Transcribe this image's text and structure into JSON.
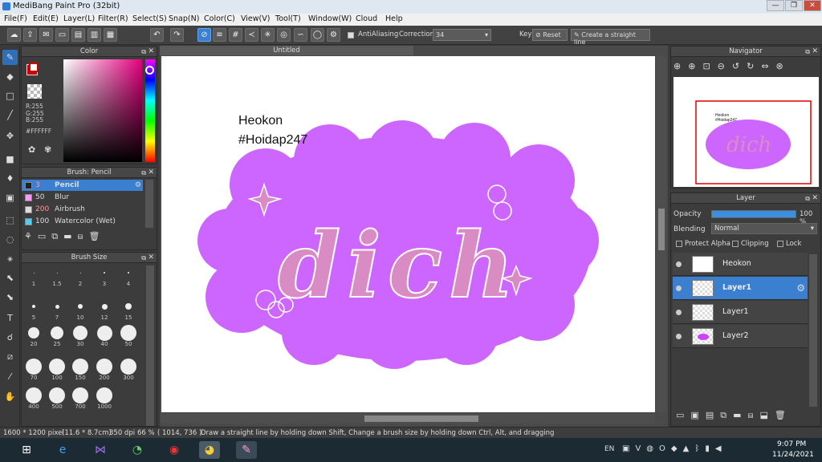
{
  "window": {
    "title": "MediBang Paint Pro (32bit)",
    "minimize": "—",
    "maximize": "❐",
    "close": "✕"
  },
  "menu": [
    "File(F)",
    "Edit(E)",
    "Layer(L)",
    "Filter(R)",
    "Select(S)",
    "Snap(N)",
    "Color(C)",
    "View(V)",
    "Tool(T)",
    "Window(W)",
    "Cloud",
    "Help"
  ],
  "toolbar": {
    "antialiasing_label": "AntiAliasing",
    "correction_label": "Correction",
    "correction_value": "34",
    "key_label": "Key",
    "reset_label": "Reset",
    "straight_line_label": "Create a straight line"
  },
  "color_panel": {
    "title": "Color",
    "r": "R:255",
    "g": "G:255",
    "b": "B:255",
    "hex": "#FFFFFF",
    "primary": "#ffffff",
    "secondary": "#cc0000"
  },
  "brush_panel": {
    "title": "Brush: Pencil",
    "brushes": [
      {
        "size": "3",
        "name": "Pencil",
        "swatch": "#222222",
        "selected": true
      },
      {
        "size": "50",
        "name": "Blur",
        "swatch": "#ff99ff",
        "selected": false
      },
      {
        "size": "200",
        "name": "Airbrush",
        "swatch": "#dddddd",
        "selected": false
      },
      {
        "size": "100",
        "name": "Watercolor (Wet)",
        "swatch": "#55ccee",
        "selected": false
      }
    ]
  },
  "brush_size_panel": {
    "title": "Brush Size",
    "rows": [
      [
        "1",
        "1.5",
        "2",
        "3",
        "4"
      ],
      [
        "5",
        "7",
        "10",
        "12",
        "15"
      ],
      [
        "20",
        "25",
        "30",
        "40",
        "50"
      ],
      [
        "70",
        "100",
        "150",
        "200",
        "300"
      ],
      [
        "400",
        "500",
        "700",
        "1000"
      ]
    ]
  },
  "document": {
    "tab_title": "Untitled",
    "text_line1": "Heokon",
    "text_line2": "#Hoidap247",
    "lettering": "dich",
    "blob_color": "#cc66ff",
    "lettering_color": "#d98cc4"
  },
  "navigator": {
    "title": "Navigator",
    "text_line1": "Heokon",
    "text_line2": "#Hoidap247"
  },
  "layer_panel": {
    "title": "Layer",
    "opacity_label": "Opacity",
    "opacity_value": "100 %",
    "opacity_fraction": 1.0,
    "blending_label": "Blending",
    "blending_value": "Normal",
    "protect_alpha": "Protect Alpha",
    "clipping": "Clipping",
    "lock": "Lock",
    "layers": [
      {
        "name": "Heokon",
        "selected": false
      },
      {
        "name": "Layer1",
        "selected": true
      },
      {
        "name": "Layer1",
        "selected": false
      },
      {
        "name": "Layer2",
        "selected": false
      }
    ]
  },
  "status": {
    "size": "1600 * 1200 pixel",
    "cm": "(11.6 * 8.7cm)",
    "dpi": "350 dpi",
    "zoom": "66 %",
    "coords": "( 1014, 736 )",
    "hint": "Draw a straight line by holding down Shift, Change a brush size by holding down Ctrl, Alt, and dragging"
  },
  "taskbar": {
    "lang": "EN",
    "time": "9:07 PM",
    "date": "11/24/2021"
  }
}
